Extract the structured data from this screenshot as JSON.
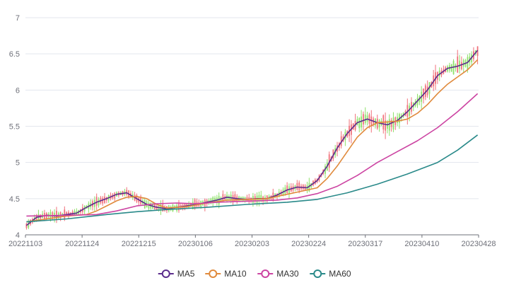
{
  "chart_data": {
    "type": "candlestick",
    "x_tick_labels": [
      "20221103",
      "20221124",
      "20221215",
      "20230106",
      "20230203",
      "20230224",
      "20230317",
      "20230410",
      "20230428"
    ],
    "y_tick_labels": [
      "4",
      "4.5",
      "5",
      "5.5",
      "6",
      "6.5",
      "7"
    ],
    "ylim": [
      4,
      7
    ],
    "grid": "horizontal",
    "legend_position": "bottom",
    "candle_colors": {
      "up": "#f0707a",
      "down": "#8ee06a"
    },
    "series": [
      {
        "name": "MA5",
        "color": "#5b2d8c",
        "points": [
          [
            0,
            4.13
          ],
          [
            5,
            4.24
          ],
          [
            10,
            4.27
          ],
          [
            15,
            4.26
          ],
          [
            20,
            4.28
          ],
          [
            25,
            4.3
          ],
          [
            30,
            4.38
          ],
          [
            35,
            4.45
          ],
          [
            40,
            4.5
          ],
          [
            45,
            4.56
          ],
          [
            50,
            4.58
          ],
          [
            55,
            4.5
          ],
          [
            60,
            4.42
          ],
          [
            65,
            4.38
          ],
          [
            70,
            4.36
          ],
          [
            75,
            4.38
          ],
          [
            80,
            4.4
          ],
          [
            85,
            4.42
          ],
          [
            90,
            4.45
          ],
          [
            95,
            4.48
          ],
          [
            100,
            4.52
          ],
          [
            105,
            4.5
          ],
          [
            110,
            4.49
          ],
          [
            115,
            4.5
          ],
          [
            120,
            4.5
          ],
          [
            125,
            4.55
          ],
          [
            130,
            4.62
          ],
          [
            135,
            4.66
          ],
          [
            140,
            4.65
          ],
          [
            145,
            4.75
          ],
          [
            150,
            4.95
          ],
          [
            155,
            5.2
          ],
          [
            160,
            5.4
          ],
          [
            165,
            5.55
          ],
          [
            170,
            5.6
          ],
          [
            175,
            5.55
          ],
          [
            180,
            5.52
          ],
          [
            185,
            5.58
          ],
          [
            190,
            5.7
          ],
          [
            195,
            5.85
          ],
          [
            200,
            6.0
          ],
          [
            205,
            6.2
          ],
          [
            210,
            6.3
          ],
          [
            215,
            6.33
          ],
          [
            220,
            6.38
          ],
          [
            225,
            6.55
          ]
        ]
      },
      {
        "name": "MA10",
        "color": "#e08a3c",
        "points": [
          [
            0,
            4.18
          ],
          [
            10,
            4.22
          ],
          [
            20,
            4.26
          ],
          [
            30,
            4.28
          ],
          [
            35,
            4.33
          ],
          [
            40,
            4.4
          ],
          [
            45,
            4.47
          ],
          [
            50,
            4.52
          ],
          [
            55,
            4.53
          ],
          [
            60,
            4.5
          ],
          [
            65,
            4.42
          ],
          [
            70,
            4.37
          ],
          [
            80,
            4.39
          ],
          [
            90,
            4.44
          ],
          [
            100,
            4.48
          ],
          [
            110,
            4.49
          ],
          [
            120,
            4.5
          ],
          [
            130,
            4.56
          ],
          [
            140,
            4.62
          ],
          [
            145,
            4.65
          ],
          [
            150,
            4.78
          ],
          [
            155,
            4.95
          ],
          [
            160,
            5.15
          ],
          [
            165,
            5.35
          ],
          [
            170,
            5.48
          ],
          [
            175,
            5.55
          ],
          [
            180,
            5.56
          ],
          [
            185,
            5.57
          ],
          [
            190,
            5.6
          ],
          [
            195,
            5.68
          ],
          [
            200,
            5.8
          ],
          [
            205,
            5.95
          ],
          [
            210,
            6.08
          ],
          [
            215,
            6.18
          ],
          [
            220,
            6.28
          ],
          [
            225,
            6.42
          ]
        ]
      },
      {
        "name": "MA30",
        "color": "#cc44a2",
        "points": [
          [
            0,
            4.26
          ],
          [
            20,
            4.27
          ],
          [
            35,
            4.28
          ],
          [
            45,
            4.33
          ],
          [
            55,
            4.4
          ],
          [
            65,
            4.43
          ],
          [
            75,
            4.44
          ],
          [
            85,
            4.43
          ],
          [
            95,
            4.45
          ],
          [
            105,
            4.46
          ],
          [
            115,
            4.47
          ],
          [
            125,
            4.48
          ],
          [
            135,
            4.51
          ],
          [
            145,
            4.57
          ],
          [
            155,
            4.67
          ],
          [
            165,
            4.82
          ],
          [
            175,
            5.0
          ],
          [
            185,
            5.15
          ],
          [
            195,
            5.3
          ],
          [
            205,
            5.48
          ],
          [
            215,
            5.7
          ],
          [
            225,
            5.95
          ]
        ]
      },
      {
        "name": "MA60",
        "color": "#2a8a8a",
        "points": [
          [
            0,
            4.18
          ],
          [
            20,
            4.22
          ],
          [
            40,
            4.28
          ],
          [
            55,
            4.32
          ],
          [
            70,
            4.35
          ],
          [
            90,
            4.38
          ],
          [
            110,
            4.42
          ],
          [
            130,
            4.45
          ],
          [
            145,
            4.49
          ],
          [
            160,
            4.58
          ],
          [
            175,
            4.7
          ],
          [
            190,
            4.84
          ],
          [
            205,
            5.0
          ],
          [
            215,
            5.17
          ],
          [
            225,
            5.38
          ]
        ]
      }
    ]
  },
  "legend": {
    "items": [
      {
        "label": "MA5",
        "color": "#5b2d8c"
      },
      {
        "label": "MA10",
        "color": "#e08a3c"
      },
      {
        "label": "MA30",
        "color": "#cc44a2"
      },
      {
        "label": "MA60",
        "color": "#2a8a8a"
      }
    ]
  }
}
